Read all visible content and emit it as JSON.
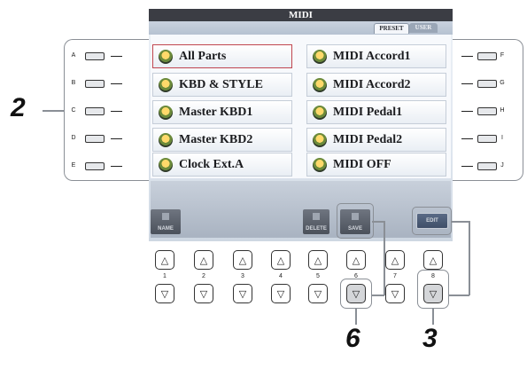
{
  "screen": {
    "title": "MIDI",
    "tabs": [
      {
        "label": "PRESET"
      },
      {
        "label": "USER"
      }
    ],
    "items": [
      {
        "label": "All Parts",
        "icon": "midi-icon"
      },
      {
        "label": "KBD & STYLE",
        "icon": "midi-icon"
      },
      {
        "label": "Master KBD1",
        "icon": "midi-icon"
      },
      {
        "label": "Master KBD2",
        "icon": "midi-icon"
      },
      {
        "label": "Clock Ext.A",
        "icon": "midi-icon"
      },
      {
        "label": "MIDI Accord1",
        "icon": "midi-icon"
      },
      {
        "label": "MIDI Accord2",
        "icon": "midi-icon"
      },
      {
        "label": "MIDI Pedal1",
        "icon": "midi-icon"
      },
      {
        "label": "MIDI Pedal2",
        "icon": "midi-icon"
      },
      {
        "label": "MIDI OFF",
        "icon": "midi-icon"
      }
    ],
    "bottom_buttons": {
      "name": "NAME",
      "delete": "DELETE",
      "save": "SAVE",
      "edit": "EDIT"
    }
  },
  "side_buttons": {
    "left": [
      "A",
      "B",
      "C",
      "D",
      "E"
    ],
    "right": [
      "F",
      "G",
      "H",
      "I",
      "J"
    ]
  },
  "number_buttons": [
    "1",
    "2",
    "3",
    "4",
    "5",
    "6",
    "7",
    "8"
  ],
  "callouts": {
    "left": "2",
    "bottom_save": "6",
    "bottom_edit": "3"
  }
}
